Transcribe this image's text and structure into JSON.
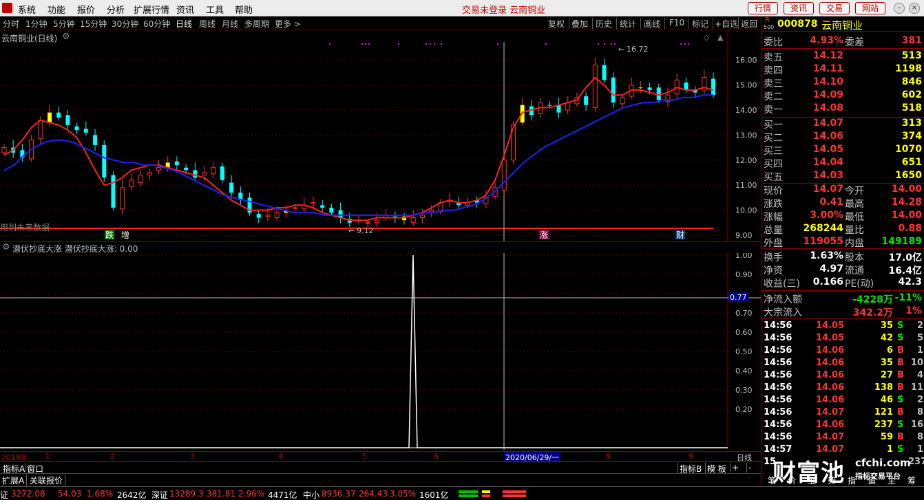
{
  "menubar": {
    "items": [
      "系统",
      "功能",
      "报价",
      "分析",
      "扩展行情",
      "资讯",
      "工具",
      "帮助"
    ],
    "center_title": "交易未登录  云南铜业",
    "quick_buttons": [
      "行情",
      "资讯",
      "交易",
      "网站"
    ]
  },
  "periodbar": {
    "periods": [
      "分时",
      "1分钟",
      "5分钟",
      "15分钟",
      "30分钟",
      "60分钟",
      "日线",
      "周线",
      "月线",
      "多周期",
      "更多 >"
    ],
    "active_period": "日线",
    "tools": [
      "复权",
      "叠加",
      "历史",
      "统计",
      "画线",
      "F10",
      "标记",
      "+自选",
      "返回"
    ]
  },
  "main_chart": {
    "title": "云南铜业(日线)",
    "watermark_text": "用到未来数据",
    "high_label": "16.72",
    "low_label": "9.12",
    "event_tags": [
      "跌",
      "增",
      "涨",
      "财"
    ],
    "y_ticks": [
      "16.00",
      "15.00",
      "14.00",
      "13.00",
      "12.00",
      "11.00",
      "10.00",
      "9.00"
    ]
  },
  "chart_data": [
    {
      "type": "candlestick",
      "title": "云南铜业(日线)",
      "ylim": [
        9.0,
        16.72
      ],
      "y_ticks": [
        9.0,
        10.0,
        11.0,
        12.0,
        13.0,
        14.0,
        15.0,
        16.0
      ],
      "annotations": {
        "high": 16.72,
        "low": 9.12
      },
      "x_labels": [
        "2019年",
        "1",
        "2",
        "3",
        "4",
        "5",
        "6",
        "2020/06/29/一",
        "8",
        "9"
      ],
      "close_series": [
        12.5,
        12.3,
        12.1,
        12.8,
        13.6,
        13.9,
        13.7,
        13.4,
        13.2,
        13.1,
        12.6,
        11.3,
        10.1,
        10.9,
        11.2,
        11.4,
        11.5,
        11.7,
        11.9,
        11.8,
        11.6,
        11.3,
        11.5,
        11.7,
        11.2,
        10.7,
        10.4,
        9.9,
        9.7,
        9.8,
        9.9,
        10.0,
        10.1,
        10.2,
        10.3,
        10.1,
        9.9,
        9.7,
        9.5,
        9.6,
        9.5,
        9.6,
        9.8,
        9.7,
        9.6,
        9.7,
        9.8,
        10.0,
        10.3,
        10.4,
        10.2,
        10.3,
        10.3,
        10.5,
        10.9,
        12.0,
        13.4,
        14.2,
        13.8,
        14.3,
        14.2,
        13.9,
        14.3,
        14.5,
        14.2,
        15.8,
        15.2,
        14.3,
        14.5,
        15.0,
        14.9,
        14.8,
        14.4,
        14.6,
        15.2,
        14.8,
        14.7,
        15.3,
        14.6
      ],
      "series": [
        {
          "name": "MA1",
          "color": "#ff2020",
          "values": [
            12.2,
            12.4,
            12.8,
            13.3,
            13.6,
            13.5,
            13.4,
            13.2,
            12.9,
            12.3,
            11.6,
            11.0,
            11.1,
            11.3,
            11.6,
            11.7,
            11.8,
            11.8,
            11.7,
            11.6,
            11.5,
            11.4,
            11.3,
            11.0,
            10.7,
            10.4,
            10.2,
            10.0,
            10.0,
            10.0,
            10.1,
            10.1,
            10.2,
            10.2,
            10.1,
            9.9,
            9.8,
            9.7,
            9.6,
            9.6,
            9.6,
            9.7,
            9.7,
            9.7,
            9.7,
            9.8,
            9.9,
            10.1,
            10.3,
            10.4,
            10.3,
            10.3,
            10.4,
            10.6,
            11.2,
            12.2,
            13.3,
            13.9,
            14.0,
            14.1,
            14.1,
            14.2,
            14.3,
            14.4,
            14.9,
            15.3,
            15.0,
            14.6,
            14.6,
            14.8,
            14.8,
            14.7,
            14.6,
            14.7,
            14.9,
            14.8,
            14.8,
            14.9,
            14.8
          ]
        },
        {
          "name": "MA2",
          "color": "#2020ff",
          "values": [
            11.6,
            11.8,
            12.2,
            12.5,
            12.7,
            12.8,
            12.8,
            12.7,
            12.5,
            12.3,
            12.1,
            12.0,
            11.9,
            11.9,
            11.8,
            11.8,
            11.7,
            11.6,
            11.4,
            11.2,
            11.0,
            10.8,
            10.6,
            10.5,
            10.4,
            10.3,
            10.2,
            10.1,
            10.0,
            9.9,
            9.9,
            9.9,
            9.8,
            9.8,
            9.8,
            9.8,
            9.8,
            9.8,
            9.8,
            9.8,
            9.8,
            9.8,
            9.9,
            9.9,
            10.0,
            10.0,
            10.1,
            10.2,
            10.4,
            10.7,
            11.1,
            11.5,
            11.9,
            12.2,
            12.5,
            12.7,
            12.9,
            13.1,
            13.3,
            13.5,
            13.7,
            13.9,
            14.1,
            14.2,
            14.3,
            14.3,
            14.4,
            14.4,
            14.5,
            14.5,
            14.6,
            14.6
          ]
        }
      ]
    },
    {
      "type": "line",
      "title": "潜伏抄底大涨 潜伏抄底大涨: 0.00",
      "ylim": [
        0,
        1.05
      ],
      "y_ticks": [
        0.2,
        0.3,
        0.4,
        0.5,
        0.6,
        0.7,
        0.8,
        0.9,
        1.0
      ],
      "series": [
        {
          "name": "潜伏抄底大涨",
          "values": [
            0,
            0,
            1.0,
            0,
            0
          ]
        }
      ],
      "crosshair_value": 0.77
    }
  ],
  "sub_chart": {
    "title": "潜伏抄底大涨  潜伏抄底大涨: 0.00",
    "y_ticks": [
      "1.00",
      "0.90",
      "0.70",
      "0.60",
      "0.50",
      "0.40",
      "0.30",
      "0.20"
    ],
    "crosshair_label": "0.77"
  },
  "timeaxis": {
    "labels": [
      "2019年",
      "1",
      "2",
      "3",
      "4",
      "5",
      "6",
      "2020/06/29/一",
      "8",
      "9"
    ],
    "period_label": "日线"
  },
  "tabs1": {
    "items": [
      "指标A",
      "窗口"
    ],
    "right": [
      "指标B",
      "模 板",
      "+",
      "-"
    ]
  },
  "tabs2": {
    "items": [
      "扩展A",
      "关联报价"
    ]
  },
  "statusbar": {
    "sh": {
      "label": "证",
      "index": "3272.08",
      "chg": "54.03",
      "pct": "1.68%",
      "amt": "2642亿"
    },
    "sz": {
      "label": "深证",
      "index": "13289.3",
      "chg": "381.81",
      "pct": "2.96%",
      "amt": "4471亿"
    },
    "zx": {
      "label": "中小",
      "index": "8936.37",
      "chg": "264.43",
      "pct": "3.05%",
      "amt": "1601亿"
    }
  },
  "rightpanel": {
    "code": "000878",
    "name": "云南铜业",
    "r_tag": "R",
    "r_sub": "500",
    "weibi": {
      "label": "委比",
      "value": "4.93%",
      "label2": "委差",
      "value2": "381"
    },
    "sell": [
      {
        "label": "卖五",
        "price": "14.12",
        "vol": "513"
      },
      {
        "label": "卖四",
        "price": "14.11",
        "vol": "1198"
      },
      {
        "label": "卖三",
        "price": "14.10",
        "vol": "846"
      },
      {
        "label": "卖二",
        "price": "14.09",
        "vol": "602"
      },
      {
        "label": "卖一",
        "price": "14.08",
        "vol": "518"
      }
    ],
    "buy": [
      {
        "label": "买一",
        "price": "14.07",
        "vol": "313"
      },
      {
        "label": "买二",
        "price": "14.06",
        "vol": "374"
      },
      {
        "label": "买三",
        "price": "14.05",
        "vol": "1070"
      },
      {
        "label": "买四",
        "price": "14.04",
        "vol": "651"
      },
      {
        "label": "买五",
        "price": "14.03",
        "vol": "1650"
      }
    ],
    "stats": [
      {
        "l1": "现价",
        "v1": "14.07",
        "l2": "今开",
        "v2": "14.00"
      },
      {
        "l1": "涨跌",
        "v1": "0.41",
        "l2": "最高",
        "v2": "14.28"
      },
      {
        "l1": "涨幅",
        "v1": "3.00%",
        "l2": "最低",
        "v2": "14.00"
      },
      {
        "l1": "总量",
        "v1": "268244",
        "l2": "量比",
        "v2": "0.88"
      },
      {
        "l1": "外盘",
        "v1": "119055",
        "l2": "内盘",
        "v2": "149189"
      }
    ],
    "fund": [
      {
        "l1": "换手",
        "v1": "1.63%",
        "l2": "股本",
        "v2": "17.0亿"
      },
      {
        "l1": "净资",
        "v1": "4.97",
        "l2": "流通",
        "v2": "16.4亿"
      },
      {
        "l1": "收益(三)",
        "v1": "0.166",
        "l2": "PE(动)",
        "v2": "42.3"
      }
    ],
    "flow": [
      {
        "label": "净流入额",
        "value": "-4228万",
        "pct": "-11%"
      },
      {
        "label": "大宗流入",
        "value": "342.2万",
        "pct": "1%"
      }
    ],
    "ticks": [
      {
        "time": "14:56",
        "price": "14.05",
        "vol": "35",
        "bs": "S",
        "n": "2"
      },
      {
        "time": "14:56",
        "price": "14.05",
        "vol": "42",
        "bs": "S",
        "n": "5"
      },
      {
        "time": "14:56",
        "price": "14.06",
        "vol": "6",
        "bs": "B",
        "n": "1"
      },
      {
        "time": "14:56",
        "price": "14.06",
        "vol": "35",
        "bs": "B",
        "n": "10"
      },
      {
        "time": "14:56",
        "price": "14.06",
        "vol": "27",
        "bs": "B",
        "n": "4"
      },
      {
        "time": "14:56",
        "price": "14.06",
        "vol": "138",
        "bs": "B",
        "n": "11"
      },
      {
        "time": "14:56",
        "price": "14.06",
        "vol": "46",
        "bs": "S",
        "n": "2"
      },
      {
        "time": "14:56",
        "price": "14.07",
        "vol": "121",
        "bs": "B",
        "n": "8"
      },
      {
        "time": "14:56",
        "price": "14.06",
        "vol": "237",
        "bs": "S",
        "n": "16"
      },
      {
        "time": "14:56",
        "price": "14.07",
        "vol": "59",
        "bs": "B",
        "n": "8"
      },
      {
        "time": "14:57",
        "price": "14.07",
        "vol": "1",
        "bs": "S",
        "n": "1"
      },
      {
        "time": "15",
        "price": "",
        "vol": "",
        "bs": "",
        "n": "237"
      }
    ],
    "bottom_tabs": [
      "笔",
      "价",
      "细",
      "势",
      "指",
      "值",
      "主",
      "筹"
    ]
  },
  "watermark": {
    "logo": "财富池",
    "site": "cfchi.com",
    "sub": "指标交易平台"
  }
}
